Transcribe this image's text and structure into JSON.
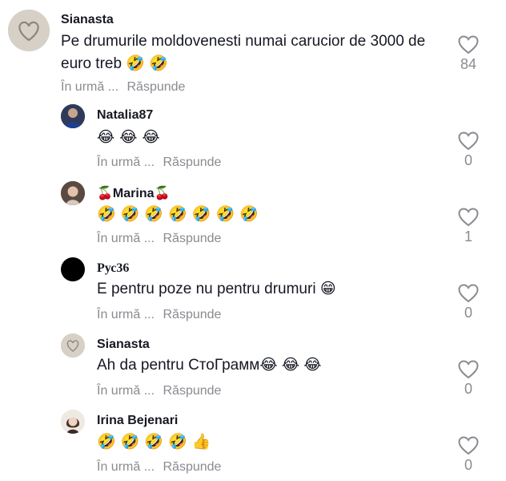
{
  "comments": [
    {
      "name": "Sianasta",
      "text": "Pe drumurile moldovenesti numai carucior de 3000 de euro treb 🤣 🤣",
      "when": "În urmă ...",
      "reply": "Răspunde",
      "likes": "84"
    },
    {
      "name": "Natalia87",
      "text": "😂 😂 😂",
      "when": "În urmă ...",
      "reply": "Răspunde",
      "likes": "0"
    },
    {
      "name": "🍒Marina🍒",
      "text": "🤣 🤣 🤣 🤣 🤣 🤣 🤣",
      "when": "În urmă ...",
      "reply": "Răspunde",
      "likes": "1"
    },
    {
      "name": "Рус36",
      "text": "E pentru poze nu pentru drumuri 😁",
      "when": "În urmă ...",
      "reply": "Răspunde",
      "likes": "0"
    },
    {
      "name": "Sianasta",
      "text": "Ah da pentru СтоГрамм😂 😂 😂",
      "when": "În urmă ...",
      "reply": "Răspunde",
      "likes": "0"
    },
    {
      "name": "Irina Bejenari",
      "text": "🤣 🤣 🤣 🤣 👍",
      "when": "În urmă ...",
      "reply": "Răspunde",
      "likes": "0"
    }
  ],
  "icons": {
    "like": "heart-outline-icon"
  },
  "colors": {
    "text": "#161823",
    "muted": "#8a8b91"
  }
}
